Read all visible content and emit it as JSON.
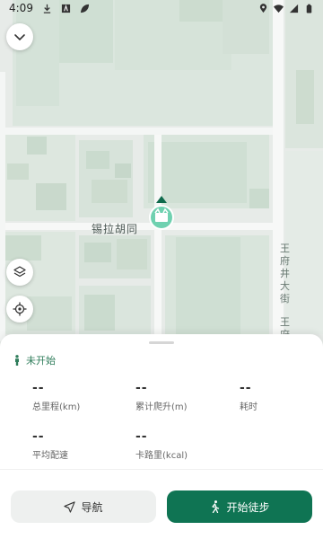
{
  "status_bar": {
    "time": "4:09",
    "left_icons": [
      "download-icon",
      "app-icon",
      "leaf-icon"
    ],
    "right_icons": [
      "location-icon",
      "wifi-icon",
      "signal-icon",
      "battery-icon"
    ]
  },
  "map": {
    "street_label": "锡拉胡同",
    "side_street_label": "王府井大街",
    "side_street_label_partial": "王府"
  },
  "controls": {
    "collapse_icon": "chevron-down-icon",
    "layers_icon": "layers-icon",
    "locate_icon": "crosshair-icon"
  },
  "panel": {
    "status_text": "未开始",
    "stats": [
      {
        "value": "--",
        "label": "总里程(km)"
      },
      {
        "value": "--",
        "label": "累计爬升(m)"
      },
      {
        "value": "--",
        "label": "耗时"
      },
      {
        "value": "--",
        "label": "平均配速"
      },
      {
        "value": "--",
        "label": "卡路里(kcal)"
      }
    ],
    "nav_button": "导航",
    "start_button": "开始徒步"
  },
  "colors": {
    "accent": "#0f7453",
    "status_green": "#2f7d5b",
    "marker": "#6fd1b0"
  }
}
